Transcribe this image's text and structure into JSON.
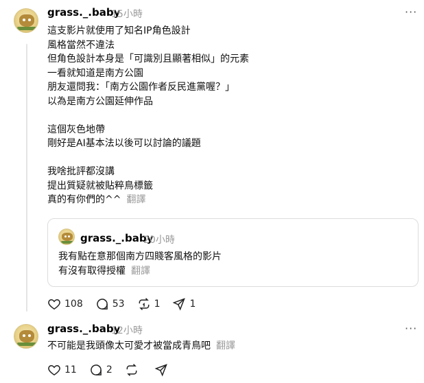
{
  "post": {
    "username": "grass._.baby",
    "time": "15小時",
    "more_label": "···",
    "lines": "這支影片就使用了知名IP角色設計\n風格當然不違法\n但角色設計本身是「可識別且顯著相似」的元素\n一看就知道是南方公園\n朋友還問我：「南方公園作者反民進黨喔？」\n以為是南方公園延伸作品\n\n這個灰色地帶\n剛好是AI基本法以後可以討論的議題\n\n我啥批評都沒講\n提出質疑就被貼粹鳥標籤\n真的有你們的^^",
    "translate": "翻譯",
    "quote": {
      "username": "grass._.baby",
      "time": "20小時",
      "lines": "我有點在意那個南方四賤客風格的影片\n有沒有取得授權",
      "translate": "翻譯"
    },
    "likes": "108",
    "comments": "53",
    "reposts": "1",
    "shares": "1"
  },
  "reply": {
    "username": "grass._.baby",
    "time": "12小時",
    "more_label": "···",
    "text": "不可能是我頭像太可愛才被當成青鳥吧",
    "translate": "翻譯",
    "likes": "11",
    "comments": "2"
  }
}
